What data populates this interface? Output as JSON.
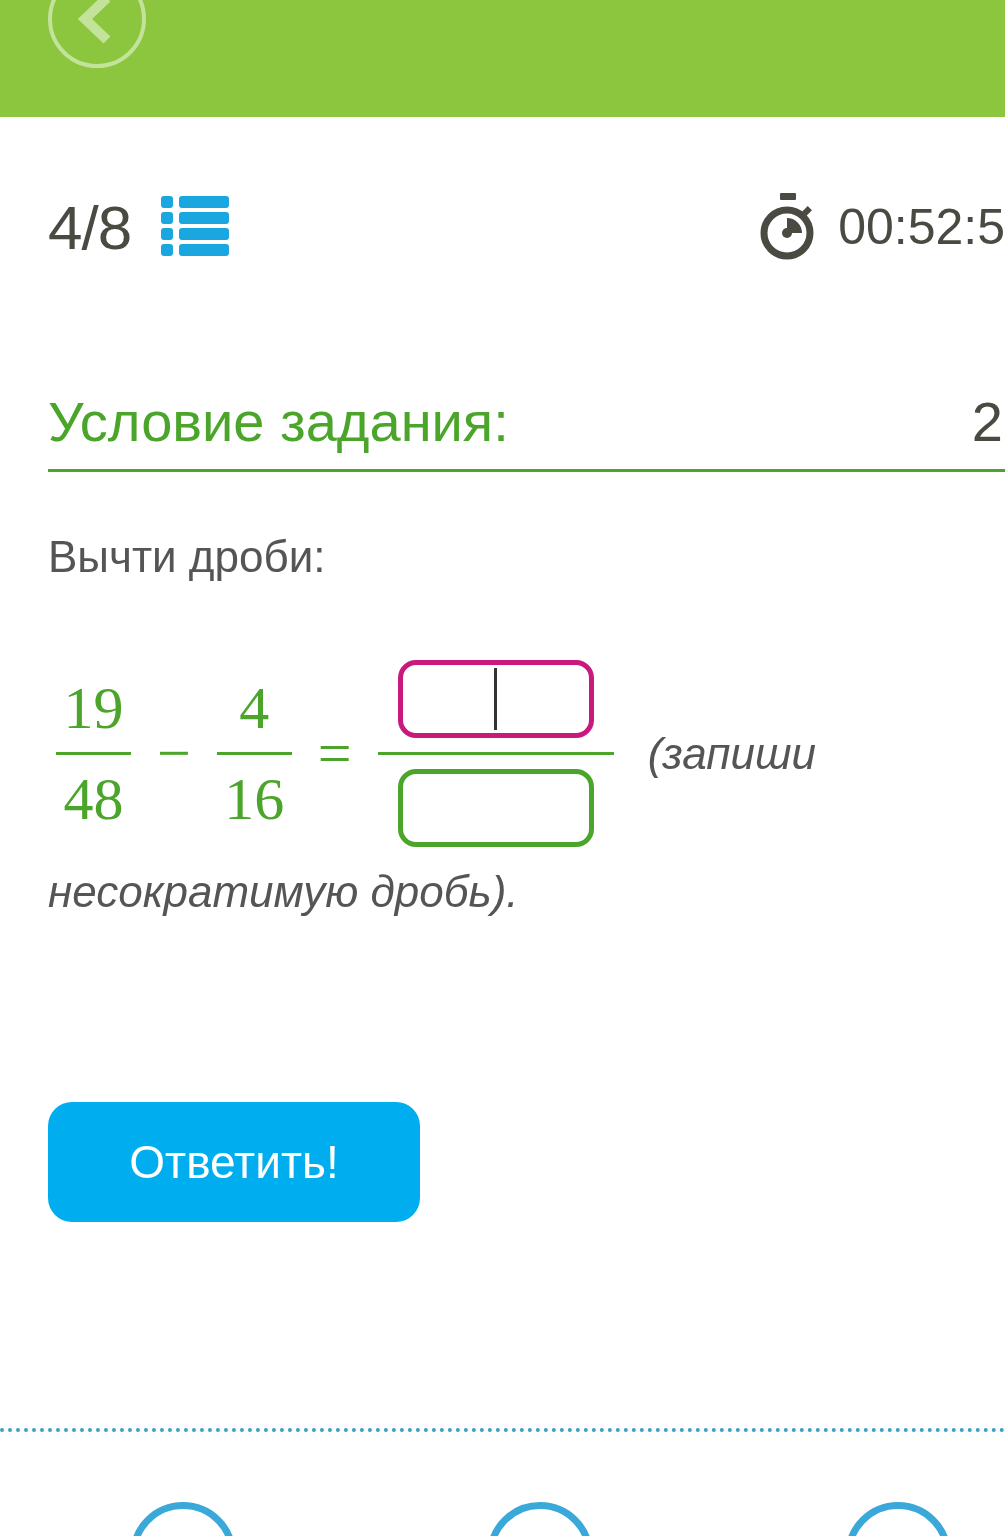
{
  "progress": "4/8",
  "timer": "00:52:5",
  "section": {
    "title": "Условие задания:",
    "points": "2"
  },
  "task": {
    "prompt": "Вычти дроби:",
    "expression": [
      {
        "kind": "fraction",
        "numerator": "19",
        "denominator": "48"
      },
      {
        "kind": "operator",
        "symbol": "−"
      },
      {
        "kind": "fraction",
        "numerator": "4",
        "denominator": "16"
      },
      {
        "kind": "operator",
        "symbol": "="
      },
      {
        "kind": "answer",
        "fields": [
          {
            "focused": true
          },
          {
            "focused": false
          }
        ]
      }
    ],
    "hint_first": "(запиши",
    "hint_rest": "несократимую дробь)."
  },
  "submit_button": "Ответить!"
}
